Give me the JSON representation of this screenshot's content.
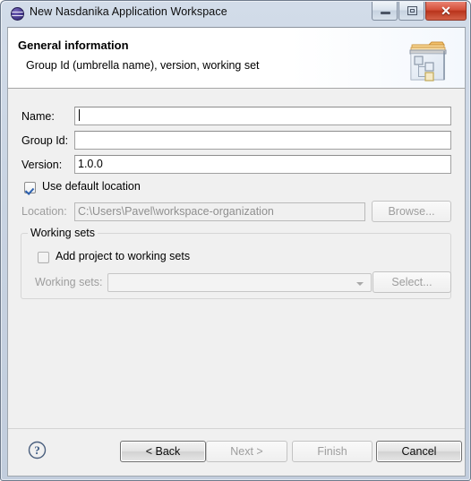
{
  "window": {
    "title": "New Nasdanika Application Workspace",
    "icon": "nasdanika-sphere-icon",
    "controls": {
      "minimize": "–",
      "maximize": "□",
      "close": "✕"
    }
  },
  "header": {
    "title": "General information",
    "subtitle": "Group Id (umbrella name), version, working set",
    "icon": "workspace-folder-diagram-icon"
  },
  "form": {
    "name": {
      "label": "Name:",
      "value": "",
      "placeholder": ""
    },
    "group_id": {
      "label": "Group Id:",
      "value": "",
      "placeholder": ""
    },
    "version": {
      "label": "Version:",
      "value": "1.0.0",
      "placeholder": ""
    },
    "use_default_location": {
      "label": "Use default location",
      "checked": true
    },
    "location": {
      "label": "Location:",
      "value": "C:\\Users\\Pavel\\workspace-organization",
      "enabled": false
    },
    "browse_button": "Browse..."
  },
  "working_sets": {
    "group_title": "Working sets",
    "add_project": {
      "label": "Add project to working sets",
      "checked": false
    },
    "sets": {
      "label": "Working sets:",
      "value": "",
      "enabled": false
    },
    "select_button": "Select..."
  },
  "buttons": {
    "help": "help-icon",
    "back": "< Back",
    "next": "Next >",
    "finish": "Finish",
    "cancel": "Cancel"
  },
  "colors": {
    "dialog_bg": "#f0f0f0",
    "header_bg": "#ffffff",
    "titlebar_bg": "#c8d3e2",
    "close_button": "#b9341c",
    "checkbox_check": "#2b5fad",
    "disabled_text": "#9d9d9d"
  }
}
